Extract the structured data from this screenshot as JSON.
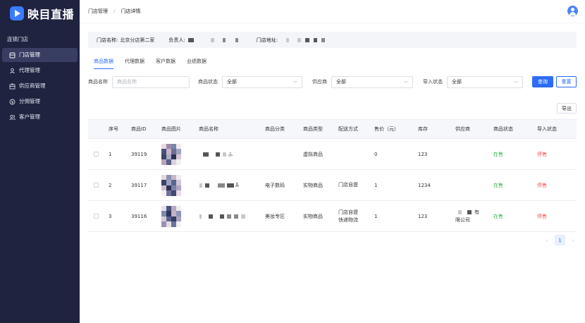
{
  "brand": {
    "name": "映目直播",
    "accent": "#3a7bff"
  },
  "sidebar": {
    "group_title": "连锁门店",
    "items": [
      {
        "label": "门店管理",
        "icon": "store-icon",
        "active": true
      },
      {
        "label": "代理管理",
        "icon": "agent-icon",
        "active": false
      },
      {
        "label": "供应商管理",
        "icon": "supplier-icon",
        "active": false
      },
      {
        "label": "分佣管理",
        "icon": "commission-icon",
        "active": false
      },
      {
        "label": "客户管理",
        "icon": "customer-icon",
        "active": false
      }
    ]
  },
  "breadcrumb": {
    "parent": "门店管理",
    "separator": "/",
    "current": "门店详情"
  },
  "store_info": {
    "name_label": "门店名称:",
    "name_value": "北京分店第二家",
    "manager_label": "负责人:",
    "address_label": "门店地址:"
  },
  "tabs": [
    {
      "label": "商品数据",
      "active": true
    },
    {
      "label": "代理数据",
      "active": false
    },
    {
      "label": "客户数据",
      "active": false
    },
    {
      "label": "业绩数据",
      "active": false
    }
  ],
  "filters": {
    "name_label": "商品名称",
    "name_placeholder": "商品名称",
    "status_label": "商品状态",
    "status_value": "全部",
    "supplier_label": "供应商",
    "supplier_value": "全部",
    "import_label": "导入状态",
    "import_value": "全部",
    "search_button": "查询",
    "reset_button": "重置"
  },
  "export_button": "导出",
  "table": {
    "columns": [
      "序号",
      "商品ID",
      "商品图片",
      "商品名称",
      "商品分类",
      "商品类型",
      "配送方式",
      "售价（元）",
      "库存",
      "供应商",
      "商品状态",
      "导入状态"
    ],
    "rows": [
      {
        "index": "1",
        "id": "39119",
        "name_tail": "ふ",
        "category": "",
        "type": "虚拟商品",
        "delivery": [
          "",
          ""
        ],
        "price": "0",
        "stock": "123",
        "supplier": [
          "",
          ""
        ],
        "status": "在售",
        "import": "停售"
      },
      {
        "index": "2",
        "id": "39117",
        "name_tail": "Å",
        "category": "电子数码",
        "type": "实物商品",
        "delivery": [
          "门店自提",
          ""
        ],
        "price": "1",
        "stock": "1234",
        "supplier": [
          "",
          ""
        ],
        "status": "在售",
        "import": "停售"
      },
      {
        "index": "3",
        "id": "39116",
        "name_tail": "",
        "category": "美妆专区",
        "type": "实物商品",
        "delivery": [
          "门店自提",
          "快递物流"
        ],
        "price": "1",
        "stock": "123",
        "supplier": [
          "有",
          "限公司"
        ],
        "status": "在售",
        "import": "停售"
      }
    ]
  },
  "pagination": {
    "current": "1",
    "prev": "‹",
    "next": "›"
  },
  "colors": {
    "primary": "#2d6cf6",
    "on_sale": "#33b24a",
    "stopped": "#f04b4b",
    "sidebar_bg": "#1f2340"
  }
}
